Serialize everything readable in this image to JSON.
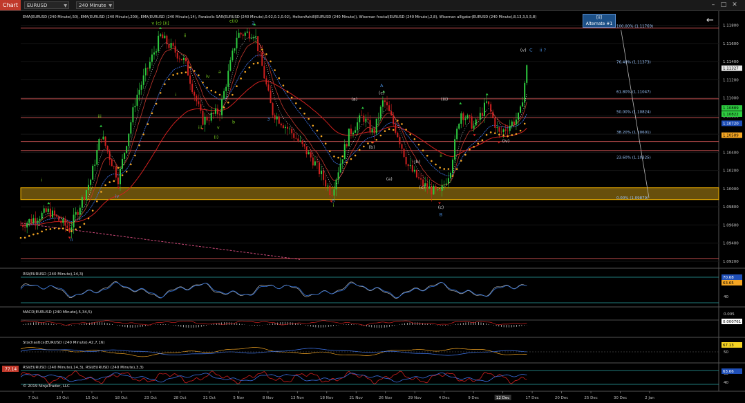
{
  "toolbar": {
    "chart_tab": "Chart",
    "instrument": "EURUSD",
    "interval": "240 Minute",
    "window_buttons": [
      "–",
      "□",
      "✕"
    ]
  },
  "overlay": {
    "badge_line1": "[ii]",
    "badge_line2": "Alternate #1",
    "back_arrow": "←"
  },
  "price_panel": {
    "indicator_caption": "EMA(EURUSD (240 Minute),50), EMA(EURUSD (240 Minute),200), EMA(EURUSD (240 Minute),14), Parabolic SAR(EURUSD (240 Minute),0.02,0.2,0.02), HeikenAshi8(EURUSD (240 Minute)), Wiseman fractal(EURUSD (240 Minute),2,8), Wiseman alligator(EURUSD (240 Minute),8,13,3,5,5,8)",
    "y_ticks": [
      "1.11800",
      "1.11600",
      "1.11400",
      "1.11200",
      "1.11000",
      "1.10800",
      "1.10600",
      "1.10400",
      "1.10200",
      "1.10000",
      "1.09800",
      "1.09600",
      "1.09400",
      "1.09200"
    ],
    "y_min": 1.092,
    "y_max": 1.1185,
    "price_markers": [
      {
        "label": "1.11327",
        "price": 1.11327,
        "color": "#e8e8e8",
        "text_color": "#000000"
      },
      {
        "label": "1.10889",
        "price": 1.10889,
        "color": "#2ecc40",
        "text_color": "#000000"
      },
      {
        "label": "1.10822",
        "price": 1.10822,
        "color": "#2ecc40",
        "text_color": "#000000"
      },
      {
        "label": "1.10720",
        "price": 1.1072,
        "color": "#1f4fb8",
        "text_color": "#ffffff"
      },
      {
        "label": "1.10589",
        "price": 1.10589,
        "color": "#f5a623",
        "text_color": "#000000"
      }
    ],
    "fib_levels": [
      {
        "label": "100.00% (1.11769)",
        "price": 1.11769
      },
      {
        "label": "76.40% (1.11373)",
        "price": 1.11373
      },
      {
        "label": "61.80% (1.11047)",
        "price": 1.11047
      },
      {
        "label": "50.00% (1.10824)",
        "price": 1.10824
      },
      {
        "label": "38.20% (1.10601)",
        "price": 1.10601
      },
      {
        "label": "23.60% (1.10325)",
        "price": 1.10325
      },
      {
        "label": "0.00% (1.09879)",
        "price": 1.09879
      }
    ],
    "horizontal_levels": [
      1.11769,
      1.1099,
      1.1078,
      1.1052,
      1.1042,
      1.0923
    ],
    "support_zone": [
      1.0988,
      1.1001
    ],
    "wave_labels": [
      {
        "text": "v (c) [ii]",
        "x": 0.2,
        "price": 1.1181,
        "color": "#7bd321"
      },
      {
        "text": "c(ii)",
        "x": 0.305,
        "price": 1.1183,
        "color": "#7bd321"
      },
      {
        "text": "2",
        "x": 0.333,
        "price": 1.1181,
        "color": "#4a90e2"
      },
      {
        "text": "iii",
        "x": 0.113,
        "price": 1.1078,
        "color": "#7bd321"
      },
      {
        "text": "ii",
        "x": 0.235,
        "price": 1.1167,
        "color": "#7bd321"
      },
      {
        "text": "iv",
        "x": 0.268,
        "price": 1.1122,
        "color": "#7bd321"
      },
      {
        "text": "a",
        "x": 0.285,
        "price": 1.1127,
        "color": "#7bd321"
      },
      {
        "text": "b",
        "x": 0.305,
        "price": 1.1072,
        "color": "#7bd321"
      },
      {
        "text": "i",
        "x": 0.222,
        "price": 1.1102,
        "color": "#7bd321"
      },
      {
        "text": "iii",
        "x": 0.257,
        "price": 1.1066,
        "color": "#7bd321"
      },
      {
        "text": "v",
        "x": 0.283,
        "price": 1.1066,
        "color": "#7bd321"
      },
      {
        "text": "(i)",
        "x": 0.28,
        "price": 1.1055,
        "color": "#7bd321"
      },
      {
        "text": "3",
        "x": 0.355,
        "price": 1.1075,
        "color": "#4a90e2"
      },
      {
        "text": "iv",
        "x": 0.138,
        "price": 1.099,
        "color": "#4a90e2"
      },
      {
        "text": "ii",
        "x": 0.073,
        "price": 1.0942,
        "color": "#4a90e2"
      },
      {
        "text": "i",
        "x": 0.03,
        "price": 1.1008,
        "color": "#7bd321"
      },
      {
        "text": "5",
        "x": 0.448,
        "price": 1.0985,
        "color": "#4a90e2"
      },
      {
        "text": "i",
        "x": 0.448,
        "price": 1.098,
        "color": "#7bd321"
      },
      {
        "text": "A",
        "x": 0.517,
        "price": 1.1112,
        "color": "#4a90e2"
      },
      {
        "text": "(c)",
        "x": 0.517,
        "price": 1.1104,
        "color": "#cccccc"
      },
      {
        "text": "(a)",
        "x": 0.478,
        "price": 1.1097,
        "color": "#cccccc"
      },
      {
        "text": "(b)",
        "x": 0.503,
        "price": 1.1044,
        "color": "#cccccc"
      },
      {
        "text": "(iii)",
        "x": 0.607,
        "price": 1.1097,
        "color": "#cccccc"
      },
      {
        "text": "ii",
        "x": 0.602,
        "price": 1.1035,
        "color": "#7bd321"
      },
      {
        "text": "(b)",
        "x": 0.568,
        "price": 1.1028,
        "color": "#cccccc"
      },
      {
        "text": "(a)",
        "x": 0.528,
        "price": 1.1009,
        "color": "#cccccc"
      },
      {
        "text": "(c)",
        "x": 0.575,
        "price": 1.1,
        "color": "#cccccc"
      },
      {
        "text": "(c)",
        "x": 0.602,
        "price": 1.0978,
        "color": "#cccccc"
      },
      {
        "text": "B",
        "x": 0.602,
        "price": 1.097,
        "color": "#4a90e2"
      },
      {
        "text": "(iv)",
        "x": 0.695,
        "price": 1.1051,
        "color": "#cccccc"
      },
      {
        "text": "(v)",
        "x": 0.72,
        "price": 1.1151,
        "color": "#cccccc"
      },
      {
        "text": "C",
        "x": 0.731,
        "price": 1.1151,
        "color": "#4a90e2"
      },
      {
        "text": "ii ?",
        "x": 0.748,
        "price": 1.1151,
        "color": "#4a90e2"
      }
    ]
  },
  "rsi_panel": {
    "label": "RSI(EURUSD (240 Minute),14,3)",
    "ticks": [
      "60",
      "40"
    ],
    "markers": [
      {
        "label": "70.68",
        "color": "#1f4fb8"
      },
      {
        "label": "63.65",
        "color": "#f5a623"
      }
    ]
  },
  "macd_panel": {
    "label": "MACD(EURUSD (240 Minute),5,34,5)",
    "ticks": [
      "0.005",
      "0"
    ],
    "markers": [
      {
        "label": "0.000761",
        "color": "#ffffff"
      }
    ]
  },
  "stoch_panel": {
    "label": "Stochastics(EURUSD (240 Minute),42,7,16)",
    "ticks": [
      "50"
    ],
    "markers": [
      {
        "label": "67.13",
        "color": "#f5d323"
      }
    ]
  },
  "rsi2_panel": {
    "label": "RSI(EURUSD (240 Minute),14,3), RSI(EURUSD (240 Minute),3,3)",
    "left_marker": "77.14",
    "ticks": [
      "60",
      "40"
    ],
    "markers": [
      {
        "label": "63.66",
        "color": "#1f4fb8"
      }
    ],
    "copyright": "© 2019 NinjaTrader, LLC"
  },
  "x_axis": {
    "ticks": [
      "7 Oct",
      "10 Oct",
      "15 Oct",
      "18 Oct",
      "23 Oct",
      "28 Oct",
      "31 Oct",
      "5 Nov",
      "8 Nov",
      "13 Nov",
      "18 Nov",
      "21 Nov",
      "26 Nov",
      "29 Nov",
      "4 Dec",
      "9 Dec",
      "12 Dec",
      "17 Dec",
      "20 Dec",
      "25 Dec",
      "30 Dec",
      "2 Jan"
    ],
    "highlight": "12 Dec"
  },
  "chart_data": {
    "type": "candlestick",
    "instrument": "EURUSD",
    "interval": "240 Minute",
    "ylim": [
      1.092,
      1.1185
    ],
    "x_range": [
      "7 Oct",
      "2 Jan"
    ],
    "anchors": [
      {
        "x": 0.0,
        "price": 1.096
      },
      {
        "x": 0.04,
        "price": 1.0975
      },
      {
        "x": 0.07,
        "price": 1.0955
      },
      {
        "x": 0.1,
        "price": 1.101
      },
      {
        "x": 0.115,
        "price": 1.106
      },
      {
        "x": 0.14,
        "price": 1.101
      },
      {
        "x": 0.165,
        "price": 1.11
      },
      {
        "x": 0.2,
        "price": 1.1168
      },
      {
        "x": 0.235,
        "price": 1.114
      },
      {
        "x": 0.26,
        "price": 1.1075
      },
      {
        "x": 0.285,
        "price": 1.1085
      },
      {
        "x": 0.31,
        "price": 1.117
      },
      {
        "x": 0.335,
        "price": 1.1172
      },
      {
        "x": 0.36,
        "price": 1.1085
      },
      {
        "x": 0.39,
        "price": 1.106
      },
      {
        "x": 0.42,
        "price": 1.103
      },
      {
        "x": 0.445,
        "price": 1.0995
      },
      {
        "x": 0.47,
        "price": 1.106
      },
      {
        "x": 0.49,
        "price": 1.108
      },
      {
        "x": 0.505,
        "price": 1.106
      },
      {
        "x": 0.52,
        "price": 1.1098
      },
      {
        "x": 0.54,
        "price": 1.106
      },
      {
        "x": 0.555,
        "price": 1.1025
      },
      {
        "x": 0.575,
        "price": 1.1005
      },
      {
        "x": 0.6,
        "price": 1.0993
      },
      {
        "x": 0.615,
        "price": 1.102
      },
      {
        "x": 0.63,
        "price": 1.1085
      },
      {
        "x": 0.65,
        "price": 1.1068
      },
      {
        "x": 0.668,
        "price": 1.1095
      },
      {
        "x": 0.685,
        "price": 1.106
      },
      {
        "x": 0.7,
        "price": 1.107
      },
      {
        "x": 0.715,
        "price": 1.108
      },
      {
        "x": 0.725,
        "price": 1.1133
      }
    ],
    "series": [
      {
        "name": "EMA 50",
        "color": "#3b6fe0"
      },
      {
        "name": "EMA 200",
        "color": "#d0201f"
      },
      {
        "name": "EMA 14",
        "color": "#c4372e"
      },
      {
        "name": "Parabolic SAR",
        "color": "#f5a623"
      },
      {
        "name": "Alligator jaw",
        "color": "#1f4fb8"
      },
      {
        "name": "Alligator teeth",
        "color": "#d0201f"
      },
      {
        "name": "Alligator lips",
        "color": "#2ecc40"
      }
    ]
  }
}
